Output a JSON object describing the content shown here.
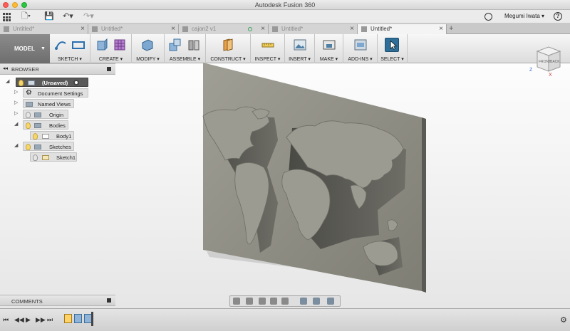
{
  "window": {
    "title": "Autodesk Fusion 360"
  },
  "quickbar": {
    "user_name": "Megumi Iwata ▾",
    "help": "?"
  },
  "tabs": [
    {
      "label": "Untitled*",
      "active": false
    },
    {
      "label": "Untitled*",
      "active": false
    },
    {
      "label": "cajon2 v1",
      "active": false
    },
    {
      "label": "Untitled*",
      "active": false
    },
    {
      "label": "Untitled*",
      "active": true
    }
  ],
  "toolbar": {
    "workspace": "MODEL",
    "groups": [
      {
        "label": "SKETCH ▾"
      },
      {
        "label": "CREATE ▾"
      },
      {
        "label": "MODIFY ▾"
      },
      {
        "label": "ASSEMBLE ▾"
      },
      {
        "label": "CONSTRUCT ▾"
      },
      {
        "label": "INSPECT ▾"
      },
      {
        "label": "INSERT ▾"
      },
      {
        "label": "MAKE ▾"
      },
      {
        "label": "ADD-INS ▾"
      },
      {
        "label": "SELECT ▾"
      }
    ]
  },
  "browser": {
    "title": "BROWSER",
    "root": "(Unsaved)",
    "items": [
      {
        "label": "Document Settings"
      },
      {
        "label": "Named Views"
      },
      {
        "label": "Origin"
      },
      {
        "label": "Bodies"
      },
      {
        "label": "Body1"
      },
      {
        "label": "Sketches"
      },
      {
        "label": "Sketch1"
      }
    ]
  },
  "comments": {
    "title": "COMMENTS"
  },
  "viewcube": {
    "front": "FRONT",
    "back": "BACK",
    "axis_z": "Z",
    "axis_x": "X"
  },
  "colors": {
    "selection_blue": "#2e6e98",
    "model_gray": "#8f8f86",
    "accent_gold": "#ffd36a"
  }
}
